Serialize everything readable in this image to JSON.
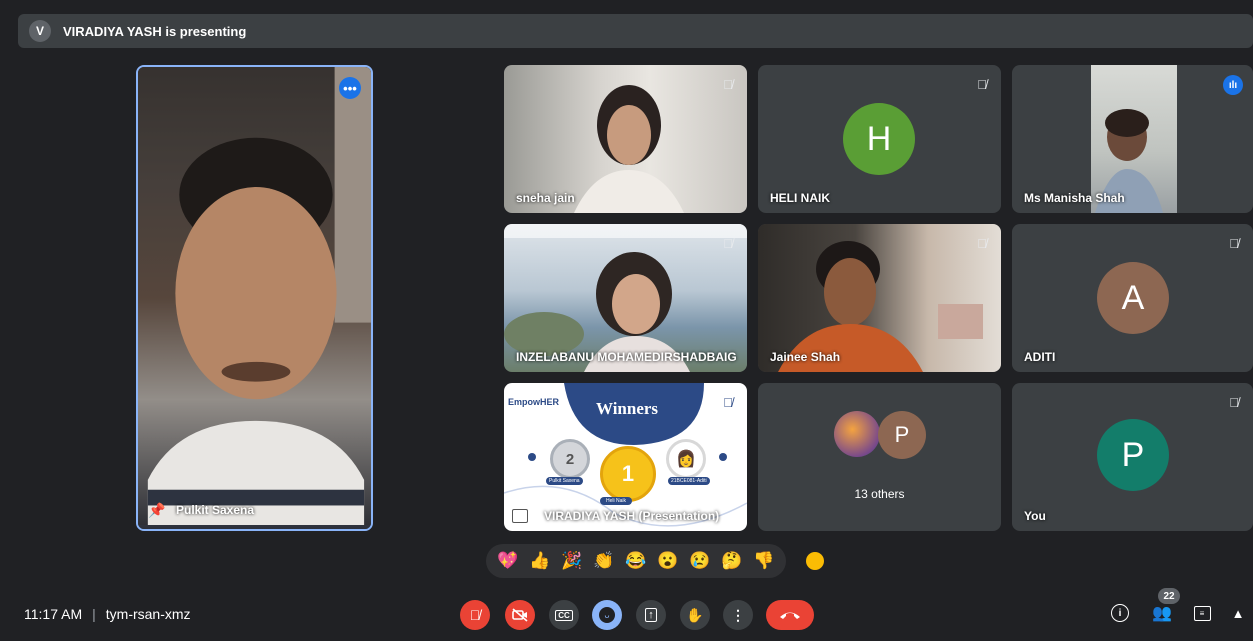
{
  "header": {
    "presenter_initial": "V",
    "presenting_text": "VIRADIYA YASH is presenting"
  },
  "main_tile": {
    "name": "Pulkit Saxena",
    "pin_icon": "pin-icon",
    "more_icon": "more-options-icon"
  },
  "tiles": {
    "sneha": {
      "name": "sneha jain",
      "mic": "mic-off-icon"
    },
    "heli": {
      "name": "HELI NAIK",
      "initial": "H",
      "color": "#5a9e35"
    },
    "manisha": {
      "name": "Ms Manisha Shah",
      "indicator": "speaking-indicator-icon"
    },
    "inzela": {
      "name": "INZELABANU MOHAMEDIRSHADBAIG"
    },
    "jainee": {
      "name": "Jainee Shah"
    },
    "aditi": {
      "name": "ADITI",
      "initial": "A",
      "color": "#8d6752"
    },
    "presentation": {
      "name": "VIRADIYA YASH (Presentation)",
      "slide_brand": "EmpowHER",
      "slide_title": "Winners",
      "place2": "2",
      "place1": "1",
      "winner1_label": "Heli Naik",
      "winner2_label": "Pulkit Saxena",
      "winner3_label": "21BCE081-Aditi"
    },
    "others": {
      "label": "13 others",
      "initial": "P",
      "color": "#8d6752"
    },
    "you": {
      "name": "You",
      "initial": "P",
      "color": "#137d6a"
    }
  },
  "reactions": [
    "💖",
    "👍",
    "🎉",
    "👏",
    "😂",
    "😮",
    "😢",
    "🤔",
    "👎"
  ],
  "bottom_bar": {
    "time": "11:17 AM",
    "separator": "|",
    "meeting_code": "tym-rsan-xmz",
    "people_count": "22"
  },
  "colors": {
    "background": "#202124",
    "tile": "#3c4043",
    "danger": "#ea4335",
    "reaction_active": "#8ab4f8",
    "speaking": "#1a73e8"
  }
}
